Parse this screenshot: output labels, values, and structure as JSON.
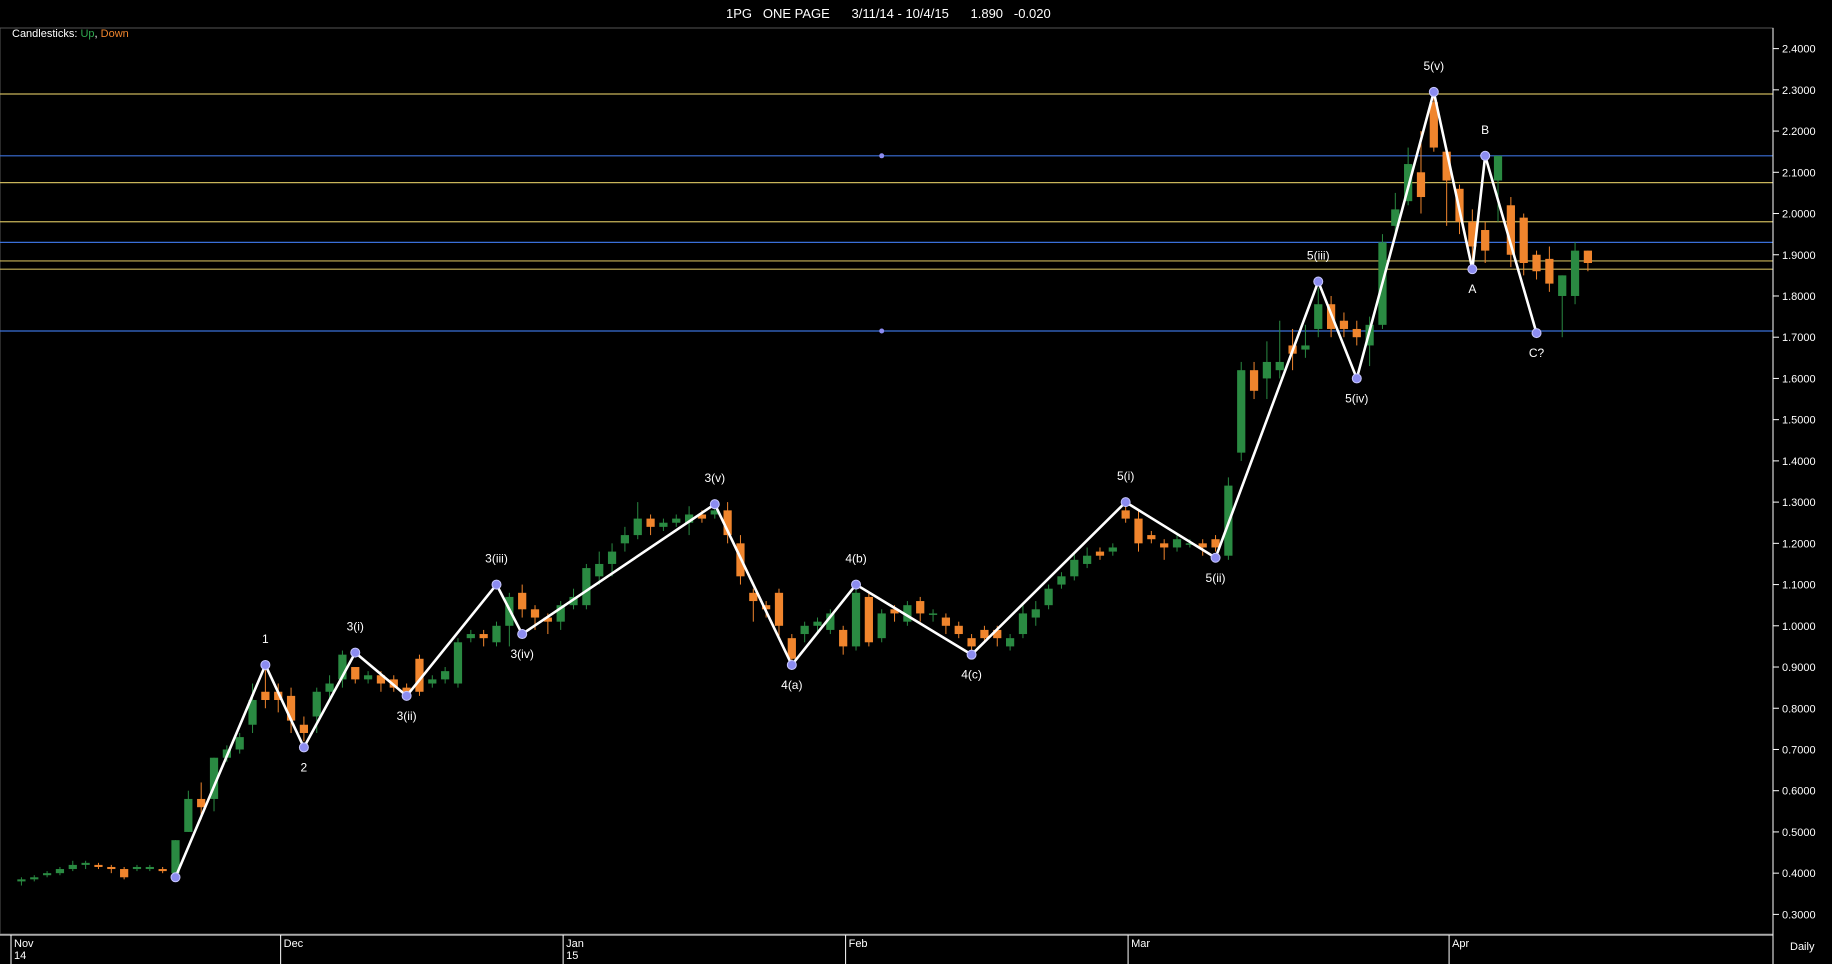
{
  "header": {
    "code": "1PG",
    "name": "ONE PAGE",
    "range": "3/11/14 - 10/4/15",
    "last": "1.890",
    "change": "-0.020"
  },
  "legend": {
    "label": "Candlesticks:",
    "up": "Up",
    "down": "Down",
    "separator": ","
  },
  "period": "Daily",
  "colors": {
    "background": "#000000",
    "up": "#2a8a42",
    "down": "#f0852d",
    "wave_line": "#ffffff",
    "wave_point": "#8c8cf0",
    "fib_gold": "#c8b45a",
    "fib_blue": "#3a6fd8",
    "grid": "#2a2a2a"
  },
  "chart_data": {
    "type": "candlestick",
    "y_axis": {
      "min": 0.25,
      "max": 2.45,
      "ticks": [
        0.3,
        0.4,
        0.5,
        0.6,
        0.7,
        0.8,
        0.9,
        1.0,
        1.1,
        1.2,
        1.3,
        1.4,
        1.5,
        1.6,
        1.7,
        1.8,
        1.9,
        2.0,
        2.1,
        2.2,
        2.3,
        2.4
      ],
      "tick_labels": [
        "0.3000",
        "0.4000",
        "0.5000",
        "0.6000",
        "0.7000",
        "0.8000",
        "0.9000",
        "1.0000",
        "1.1000",
        "1.2000",
        "1.3000",
        "1.4000",
        "1.5000",
        "1.6000",
        "1.7000",
        "1.8000",
        "1.9000",
        "2.0000",
        "2.1000",
        "2.2000",
        "2.3000",
        "2.4000"
      ]
    },
    "x_axis": {
      "months": [
        {
          "label": "Nov",
          "year": "14",
          "index": 0
        },
        {
          "label": "Dec",
          "year": "",
          "index": 21
        },
        {
          "label": "Jan",
          "year": "15",
          "index": 43
        },
        {
          "label": "Feb",
          "year": "",
          "index": 65
        },
        {
          "label": "Mar",
          "year": "",
          "index": 87
        },
        {
          "label": "Apr",
          "year": "",
          "index": 112
        }
      ],
      "total_bars": 120
    },
    "candles": [
      [
        0,
        0.38,
        0.385,
        0.37,
        0.39
      ],
      [
        1,
        0.385,
        0.39,
        0.38,
        0.395
      ],
      [
        2,
        0.395,
        0.4,
        0.39,
        0.405
      ],
      [
        3,
        0.4,
        0.41,
        0.395,
        0.415
      ],
      [
        4,
        0.41,
        0.42,
        0.405,
        0.43
      ],
      [
        5,
        0.42,
        0.425,
        0.41,
        0.43
      ],
      [
        6,
        0.42,
        0.415,
        0.41,
        0.425
      ],
      [
        7,
        0.415,
        0.41,
        0.4,
        0.42
      ],
      [
        8,
        0.41,
        0.39,
        0.385,
        0.415
      ],
      [
        9,
        0.41,
        0.415,
        0.405,
        0.42
      ],
      [
        10,
        0.41,
        0.415,
        0.405,
        0.42
      ],
      [
        11,
        0.41,
        0.405,
        0.4,
        0.415
      ],
      [
        12,
        0.4,
        0.48,
        0.39,
        0.48
      ],
      [
        13,
        0.5,
        0.58,
        0.5,
        0.6
      ],
      [
        14,
        0.58,
        0.56,
        0.53,
        0.62
      ],
      [
        15,
        0.58,
        0.68,
        0.55,
        0.68
      ],
      [
        16,
        0.68,
        0.7,
        0.67,
        0.71
      ],
      [
        17,
        0.7,
        0.73,
        0.69,
        0.74
      ],
      [
        18,
        0.76,
        0.82,
        0.74,
        0.86
      ],
      [
        19,
        0.84,
        0.82,
        0.8,
        0.9
      ],
      [
        20,
        0.84,
        0.82,
        0.79,
        0.86
      ],
      [
        21,
        0.83,
        0.77,
        0.74,
        0.85
      ],
      [
        22,
        0.76,
        0.74,
        0.72,
        0.78
      ],
      [
        23,
        0.78,
        0.84,
        0.74,
        0.85
      ],
      [
        24,
        0.84,
        0.86,
        0.82,
        0.88
      ],
      [
        25,
        0.87,
        0.93,
        0.85,
        0.94
      ],
      [
        26,
        0.9,
        0.87,
        0.86,
        0.9
      ],
      [
        27,
        0.87,
        0.88,
        0.86,
        0.89
      ],
      [
        28,
        0.88,
        0.86,
        0.84,
        0.89
      ],
      [
        29,
        0.87,
        0.85,
        0.84,
        0.88
      ],
      [
        30,
        0.85,
        0.84,
        0.83,
        0.86
      ],
      [
        31,
        0.92,
        0.84,
        0.83,
        0.93
      ],
      [
        32,
        0.86,
        0.87,
        0.85,
        0.88
      ],
      [
        33,
        0.87,
        0.89,
        0.86,
        0.9
      ],
      [
        34,
        0.86,
        0.96,
        0.85,
        0.97
      ],
      [
        35,
        0.97,
        0.98,
        0.96,
        0.99
      ],
      [
        36,
        0.98,
        0.97,
        0.95,
        0.99
      ],
      [
        37,
        0.96,
        1.0,
        0.95,
        1.01
      ],
      [
        38,
        1.0,
        1.07,
        0.95,
        1.08
      ],
      [
        39,
        1.08,
        1.04,
        1.02,
        1.1
      ],
      [
        40,
        1.04,
        1.02,
        0.99,
        1.05
      ],
      [
        41,
        1.02,
        1.01,
        0.98,
        1.03
      ],
      [
        42,
        1.01,
        1.05,
        0.99,
        1.06
      ],
      [
        43,
        1.05,
        1.07,
        1.04,
        1.09
      ],
      [
        44,
        1.05,
        1.14,
        1.04,
        1.15
      ],
      [
        45,
        1.12,
        1.15,
        1.1,
        1.18
      ],
      [
        46,
        1.15,
        1.18,
        1.12,
        1.2
      ],
      [
        47,
        1.2,
        1.22,
        1.18,
        1.24
      ],
      [
        48,
        1.22,
        1.26,
        1.21,
        1.3
      ],
      [
        49,
        1.26,
        1.24,
        1.22,
        1.27
      ],
      [
        50,
        1.24,
        1.25,
        1.23,
        1.26
      ],
      [
        51,
        1.25,
        1.26,
        1.24,
        1.27
      ],
      [
        52,
        1.25,
        1.27,
        1.22,
        1.29
      ],
      [
        53,
        1.27,
        1.26,
        1.25,
        1.28
      ],
      [
        54,
        1.27,
        1.28,
        1.26,
        1.3
      ],
      [
        55,
        1.28,
        1.22,
        1.2,
        1.3
      ],
      [
        56,
        1.2,
        1.12,
        1.1,
        1.22
      ],
      [
        57,
        1.08,
        1.06,
        1.01,
        1.09
      ],
      [
        58,
        1.05,
        1.04,
        1.02,
        1.06
      ],
      [
        59,
        1.08,
        1.0,
        0.97,
        1.09
      ],
      [
        60,
        0.97,
        0.92,
        0.91,
        0.98
      ],
      [
        61,
        0.98,
        1.0,
        0.96,
        1.01
      ],
      [
        62,
        1.0,
        1.01,
        0.98,
        1.02
      ],
      [
        63,
        0.99,
        1.03,
        0.98,
        1.04
      ],
      [
        64,
        0.99,
        0.95,
        0.93,
        1.0
      ],
      [
        65,
        0.95,
        1.08,
        0.94,
        1.09
      ],
      [
        66,
        1.07,
        0.96,
        0.95,
        1.08
      ],
      [
        67,
        0.97,
        1.03,
        0.96,
        1.04
      ],
      [
        68,
        1.04,
        1.03,
        1.01,
        1.05
      ],
      [
        69,
        1.01,
        1.05,
        1.0,
        1.06
      ],
      [
        70,
        1.06,
        1.03,
        1.01,
        1.07
      ],
      [
        71,
        1.03,
        1.03,
        1.01,
        1.04
      ],
      [
        72,
        1.02,
        1.0,
        0.98,
        1.03
      ],
      [
        73,
        1.0,
        0.98,
        0.97,
        1.01
      ],
      [
        74,
        0.97,
        0.95,
        0.93,
        0.98
      ],
      [
        75,
        0.99,
        0.97,
        0.96,
        1.0
      ],
      [
        76,
        0.99,
        0.97,
        0.95,
        1.0
      ],
      [
        77,
        0.95,
        0.97,
        0.94,
        0.98
      ],
      [
        78,
        0.98,
        1.03,
        0.97,
        1.05
      ],
      [
        79,
        1.02,
        1.04,
        1.0,
        1.06
      ],
      [
        80,
        1.05,
        1.09,
        1.04,
        1.1
      ],
      [
        81,
        1.1,
        1.12,
        1.09,
        1.13
      ],
      [
        82,
        1.12,
        1.16,
        1.11,
        1.18
      ],
      [
        83,
        1.15,
        1.17,
        1.14,
        1.19
      ],
      [
        84,
        1.18,
        1.17,
        1.16,
        1.19
      ],
      [
        85,
        1.18,
        1.19,
        1.17,
        1.2
      ],
      [
        86,
        1.28,
        1.26,
        1.25,
        1.3
      ],
      [
        87,
        1.26,
        1.2,
        1.18,
        1.28
      ],
      [
        88,
        1.22,
        1.21,
        1.2,
        1.23
      ],
      [
        89,
        1.2,
        1.19,
        1.16,
        1.21
      ],
      [
        90,
        1.19,
        1.21,
        1.18,
        1.22
      ],
      [
        91,
        1.2,
        1.2,
        1.19,
        1.21
      ],
      [
        92,
        1.2,
        1.19,
        1.17,
        1.21
      ],
      [
        93,
        1.21,
        1.19,
        1.18,
        1.22
      ],
      [
        94,
        1.17,
        1.34,
        1.16,
        1.36
      ],
      [
        95,
        1.42,
        1.62,
        1.4,
        1.64
      ],
      [
        96,
        1.62,
        1.57,
        1.55,
        1.64
      ],
      [
        97,
        1.6,
        1.64,
        1.55,
        1.69
      ],
      [
        98,
        1.62,
        1.64,
        1.6,
        1.74
      ],
      [
        99,
        1.68,
        1.66,
        1.62,
        1.72
      ],
      [
        100,
        1.67,
        1.68,
        1.65,
        1.73
      ],
      [
        101,
        1.72,
        1.78,
        1.7,
        1.82
      ],
      [
        102,
        1.78,
        1.72,
        1.7,
        1.8
      ],
      [
        103,
        1.74,
        1.72,
        1.7,
        1.76
      ],
      [
        104,
        1.72,
        1.7,
        1.68,
        1.74
      ],
      [
        105,
        1.68,
        1.73,
        1.63,
        1.75
      ],
      [
        106,
        1.73,
        1.93,
        1.72,
        1.95
      ],
      [
        107,
        1.97,
        2.01,
        1.94,
        2.05
      ],
      [
        108,
        2.03,
        2.12,
        2.02,
        2.16
      ],
      [
        109,
        2.1,
        2.04,
        2.0,
        2.2
      ],
      [
        110,
        2.27,
        2.16,
        2.15,
        2.29
      ],
      [
        111,
        2.15,
        2.08,
        1.97,
        2.16
      ],
      [
        112,
        2.06,
        1.98,
        1.95,
        2.07
      ],
      [
        113,
        1.98,
        1.92,
        1.88,
        2.01
      ],
      [
        114,
        1.96,
        1.91,
        1.88,
        1.98
      ],
      [
        115,
        2.08,
        2.14,
        1.98,
        2.14
      ],
      [
        116,
        2.02,
        1.9,
        1.87,
        2.04
      ],
      [
        117,
        1.99,
        1.88,
        1.85,
        2.0
      ],
      [
        118,
        1.9,
        1.86,
        1.84,
        1.91
      ],
      [
        119,
        1.89,
        1.83,
        1.81,
        1.92
      ]
    ],
    "tail_candles": [
      [
        120,
        1.8,
        1.85,
        1.7,
        1.85
      ],
      [
        121,
        1.8,
        1.91,
        1.78,
        1.93
      ],
      [
        122,
        1.91,
        1.88,
        1.86,
        1.91
      ]
    ],
    "fib_lines": [
      {
        "value": 2.29,
        "color": "gold"
      },
      {
        "value": 2.14,
        "color": "blue"
      },
      {
        "value": 2.075,
        "color": "gold"
      },
      {
        "value": 1.98,
        "color": "gold"
      },
      {
        "value": 1.93,
        "color": "blue"
      },
      {
        "value": 1.885,
        "color": "gold"
      },
      {
        "value": 1.865,
        "color": "gold"
      },
      {
        "value": 1.715,
        "color": "blue"
      }
    ],
    "wave_points": [
      {
        "index": 12,
        "value": 0.39,
        "label": "",
        "pos": "below"
      },
      {
        "index": 19,
        "value": 0.905,
        "label": "1",
        "pos": "above"
      },
      {
        "index": 22,
        "value": 0.705,
        "label": "2",
        "pos": "below"
      },
      {
        "index": 26,
        "value": 0.935,
        "label": "3(i)",
        "pos": "above"
      },
      {
        "index": 30,
        "value": 0.83,
        "label": "3(ii)",
        "pos": "below"
      },
      {
        "index": 37,
        "value": 1.1,
        "label": "3(iii)",
        "pos": "above"
      },
      {
        "index": 39,
        "value": 0.98,
        "label": "3(iv)",
        "pos": "below"
      },
      {
        "index": 54,
        "value": 1.295,
        "label": "3(v)",
        "pos": "above"
      },
      {
        "index": 60,
        "value": 0.905,
        "label": "4(a)",
        "pos": "below"
      },
      {
        "index": 65,
        "value": 1.1,
        "label": "4(b)",
        "pos": "above"
      },
      {
        "index": 74,
        "value": 0.93,
        "label": "4(c)",
        "pos": "below"
      },
      {
        "index": 86,
        "value": 1.3,
        "label": "5(i)",
        "pos": "above"
      },
      {
        "index": 93,
        "value": 1.165,
        "label": "5(ii)",
        "pos": "below"
      },
      {
        "index": 101,
        "value": 1.835,
        "label": "5(iii)",
        "pos": "above"
      },
      {
        "index": 104,
        "value": 1.6,
        "label": "5(iv)",
        "pos": "below"
      },
      {
        "index": 110,
        "value": 2.295,
        "label": "5(v)",
        "pos": "above"
      },
      {
        "index": 113,
        "value": 1.865,
        "label": "A",
        "pos": "below"
      },
      {
        "index": 114,
        "value": 2.14,
        "label": "B",
        "pos": "above"
      },
      {
        "index": 118,
        "value": 1.71,
        "label": "C?",
        "pos": "below"
      }
    ],
    "marker_dots": [
      {
        "index": 67,
        "value": 2.14
      },
      {
        "index": 67,
        "value": 1.715
      }
    ]
  }
}
